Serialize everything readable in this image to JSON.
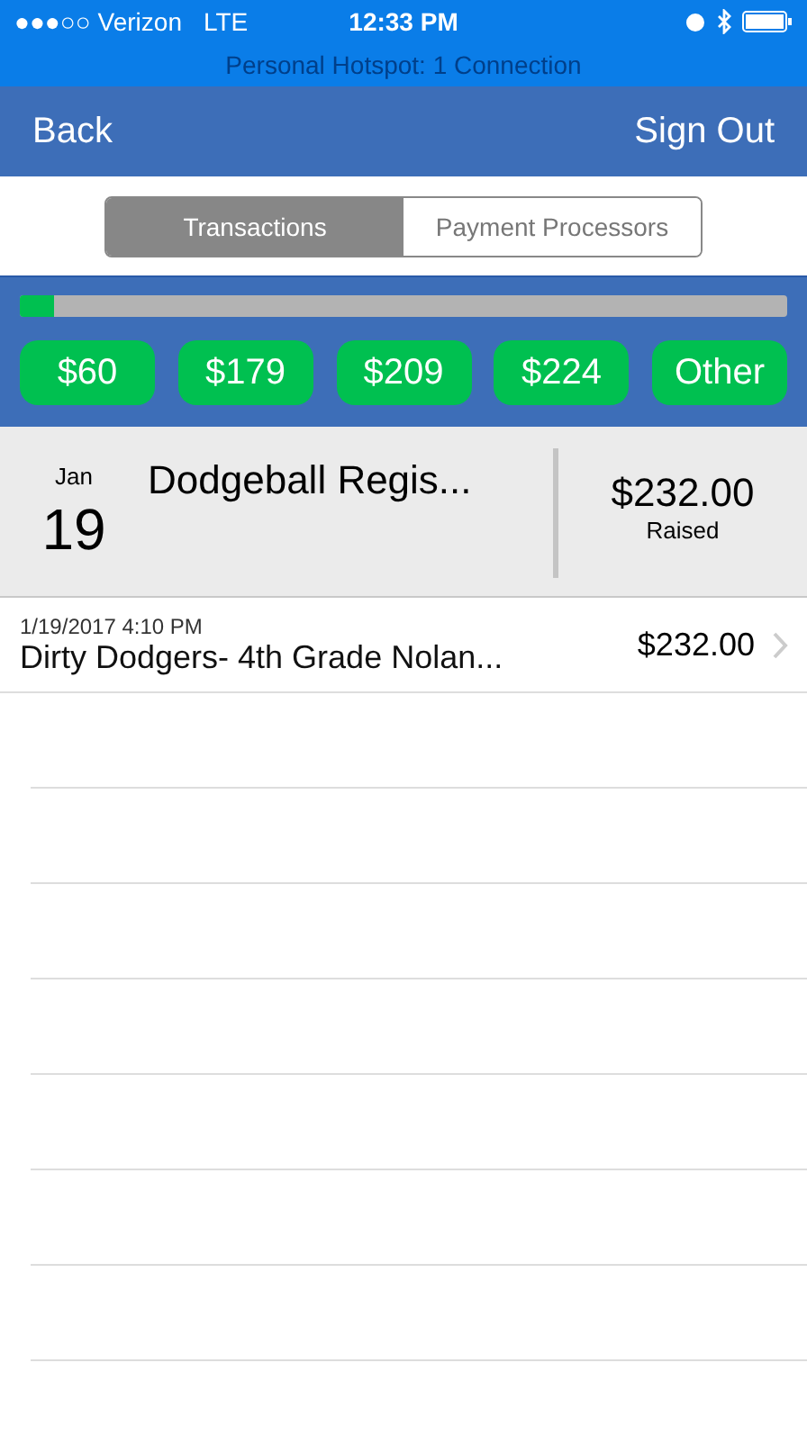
{
  "status_bar": {
    "signal": "●●●○○",
    "carrier": "Verizon",
    "network": "LTE",
    "time": "12:33 PM"
  },
  "hotspot_banner": "Personal Hotspot: 1 Connection",
  "nav": {
    "back": "Back",
    "sign_out": "Sign Out"
  },
  "segments": [
    {
      "label": "Transactions",
      "selected": true
    },
    {
      "label": "Payment Processors",
      "selected": false
    }
  ],
  "progress": {
    "level": 0.045
  },
  "amounts": [
    "$60",
    "$179",
    "$209",
    "$224",
    "Other"
  ],
  "event": {
    "month": "Jan",
    "day": "19",
    "title": "Dodgeball Regis...",
    "amount": "$232.00",
    "amount_label": "Raised"
  },
  "transactions": [
    {
      "datetime": "1/19/2017 4:10 PM",
      "name": "Dirty Dodgers- 4th Grade Nolan...",
      "amount": "$232.00"
    }
  ]
}
